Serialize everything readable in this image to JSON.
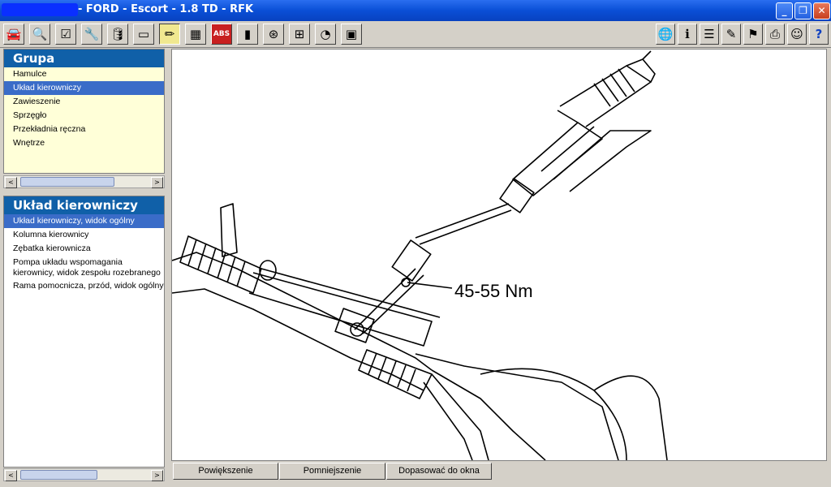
{
  "window": {
    "title": "- FORD - Escort - 1.8 TD - RFK",
    "minimize_glyph": "_",
    "restore_glyph": "❐",
    "close_glyph": "✕"
  },
  "toolbar_left": [
    {
      "icon": "car-icon",
      "glyph": "🚘"
    },
    {
      "icon": "magnifier-icon",
      "glyph": "🔍"
    },
    {
      "icon": "checklist-icon",
      "glyph": "☑"
    },
    {
      "icon": "wrench-icon",
      "glyph": "🔧"
    },
    {
      "icon": "oil-can-icon",
      "glyph": "🛢"
    },
    {
      "icon": "gauge-strip-icon",
      "glyph": "▭"
    },
    {
      "icon": "pencil-icon",
      "glyph": "✏"
    },
    {
      "icon": "circuit-icon",
      "glyph": "▦"
    },
    {
      "icon": "abs-icon",
      "glyph": "ABS"
    },
    {
      "icon": "battery-icon",
      "glyph": "▮"
    },
    {
      "icon": "steering-icon",
      "glyph": "⊛"
    },
    {
      "icon": "diagram-icon",
      "glyph": "⊞"
    },
    {
      "icon": "timing-icon",
      "glyph": "◔"
    },
    {
      "icon": "display-icon",
      "glyph": "▣"
    }
  ],
  "toolbar_right": [
    {
      "icon": "globe-icon",
      "glyph": "🌐"
    },
    {
      "icon": "info-icon",
      "glyph": "ℹ"
    },
    {
      "icon": "list-icon",
      "glyph": "☰"
    },
    {
      "icon": "notepad-icon",
      "glyph": "✎"
    },
    {
      "icon": "flag-icon",
      "glyph": "⚑"
    },
    {
      "icon": "printer-icon",
      "glyph": "⎙"
    },
    {
      "icon": "person-icon",
      "glyph": "☺"
    },
    {
      "icon": "help-icon",
      "glyph": "?"
    }
  ],
  "group_panel": {
    "title": "Grupa",
    "items": [
      {
        "label": "Hamulce",
        "selected": false
      },
      {
        "label": "Układ kierowniczy",
        "selected": true
      },
      {
        "label": "Zawieszenie",
        "selected": false
      },
      {
        "label": "Sprzęgło",
        "selected": false
      },
      {
        "label": "Przekładnia ręczna",
        "selected": false
      },
      {
        "label": "Wnętrze",
        "selected": false
      }
    ]
  },
  "section_panel": {
    "title": "Układ kierowniczy",
    "items": [
      {
        "label": "Układ kierowniczy, widok ogólny",
        "selected": true
      },
      {
        "label": "Kolumna kierownicy",
        "selected": false
      },
      {
        "label": "Zębatka kierownicza",
        "selected": false
      },
      {
        "label": "Pompa układu wspomagania kierownicy, widok zespołu rozebranego",
        "selected": false
      },
      {
        "label": "Rama pomocnicza, przód, widok ogólny",
        "selected": false
      }
    ]
  },
  "scroll": {
    "left_glyph": "<",
    "right_glyph": ">"
  },
  "drawing": {
    "torque_label": "45-55 Nm"
  },
  "bottom_buttons": {
    "zoom_in": "Powiększenie",
    "zoom_out": "Pomniejszenie",
    "fit": "Dopasować do okna"
  }
}
